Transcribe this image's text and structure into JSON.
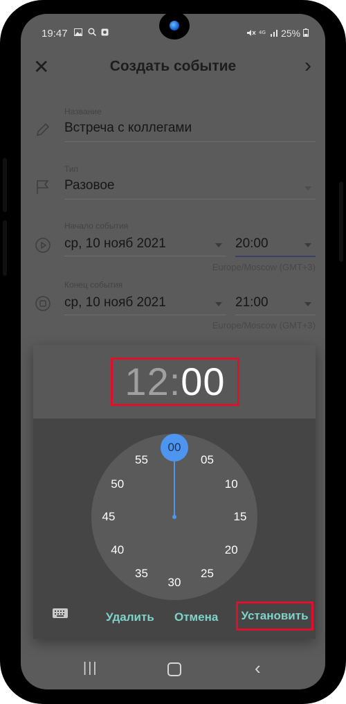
{
  "status": {
    "time": "19:47",
    "left_icons": [
      "gallery-icon",
      "search-icon",
      "app-icon"
    ],
    "right_text": "25%",
    "right_icons": [
      "mute-icon",
      "4g-icon",
      "signal-icon",
      "battery-icon"
    ]
  },
  "appbar": {
    "title": "Создать событие"
  },
  "form": {
    "name_label": "Название",
    "name_value": "Встреча с коллегами",
    "type_label": "Тип",
    "type_value": "Разовое",
    "start_label": "Начало события",
    "start_date": "ср, 10 нояб 2021",
    "start_time": "20:00",
    "start_tz": "Europe/Moscow (GMT+3)",
    "end_label": "Конец события",
    "end_date": "ср, 10 нояб 2021",
    "end_time": "21:00",
    "end_tz": "Europe/Moscow (GMT+3)"
  },
  "picker": {
    "hours": "12",
    "separator": ":",
    "minutes": "00",
    "selected_minute": "00",
    "dial_numbers": [
      "00",
      "05",
      "10",
      "15",
      "20",
      "25",
      "30",
      "35",
      "40",
      "45",
      "50",
      "55"
    ],
    "delete_label": "Удалить",
    "cancel_label": "Отмена",
    "set_label": "Установить"
  },
  "colors": {
    "accent": "#4d95ef",
    "button_text": "#7fd3c8",
    "highlight": "#e0102c"
  }
}
